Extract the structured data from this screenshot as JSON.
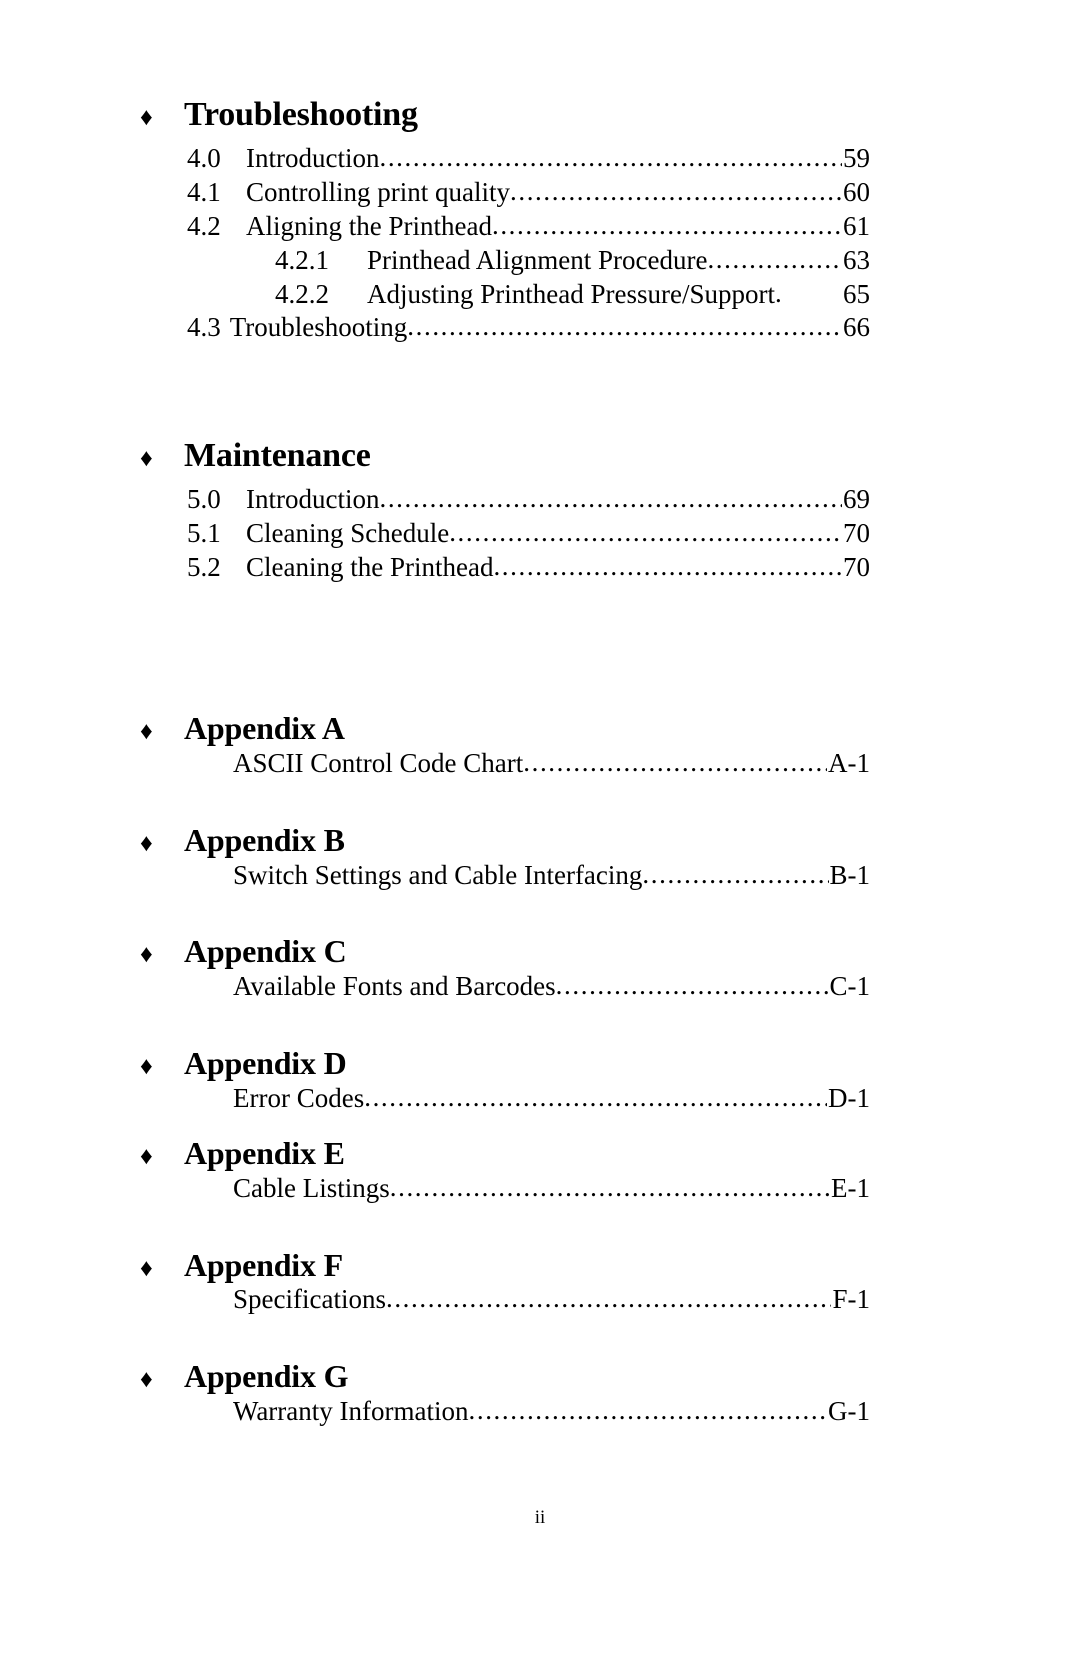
{
  "document": {
    "type": "table-of-contents",
    "bullet_glyph": "♦",
    "leader_char": ".",
    "footer_page_number": "ii"
  },
  "sections": [
    {
      "heading": "Troubleshooting",
      "entries": [
        {
          "number": "4.0",
          "title": "Introduction",
          "page": "59"
        },
        {
          "number": "4.1",
          "title": "Controlling print quality",
          "page": "60"
        },
        {
          "number": "4.2",
          "title": "Aligning the Printhead",
          "page": "61"
        },
        {
          "number": "4.2.1",
          "title": "Printhead Alignment Procedure",
          "page": "63"
        },
        {
          "number": "4.2.2",
          "title": "Adjusting Printhead Pressure/Support",
          "page": "65"
        },
        {
          "number": "4.3",
          "title": "Troubleshooting",
          "page": "66"
        }
      ]
    },
    {
      "heading": "Maintenance",
      "entries": [
        {
          "number": "5.0",
          "title": "Introduction",
          "page": "69"
        },
        {
          "number": "5.1",
          "title": "Cleaning Schedule",
          "page": "70"
        },
        {
          "number": "5.2",
          "title": "Cleaning the Printhead",
          "page": "70"
        }
      ]
    }
  ],
  "appendices": [
    {
      "heading": "Appendix A",
      "title": "ASCII Control Code Chart",
      "page": "A-1"
    },
    {
      "heading": "Appendix B",
      "title": "Switch Settings and Cable Interfacing",
      "page": "B-1"
    },
    {
      "heading": "Appendix C",
      "title": "Available Fonts and Barcodes",
      "page": "C-1"
    },
    {
      "heading": "Appendix D",
      "title": "Error Codes",
      "page": "D-1"
    },
    {
      "heading": "Appendix E",
      "title": "Cable Listings",
      "page": "E-1"
    },
    {
      "heading": "Appendix F",
      "title": "Specifications",
      "page": "F-1"
    },
    {
      "heading": "Appendix G",
      "title": "Warranty Information",
      "page": "G-1"
    }
  ]
}
